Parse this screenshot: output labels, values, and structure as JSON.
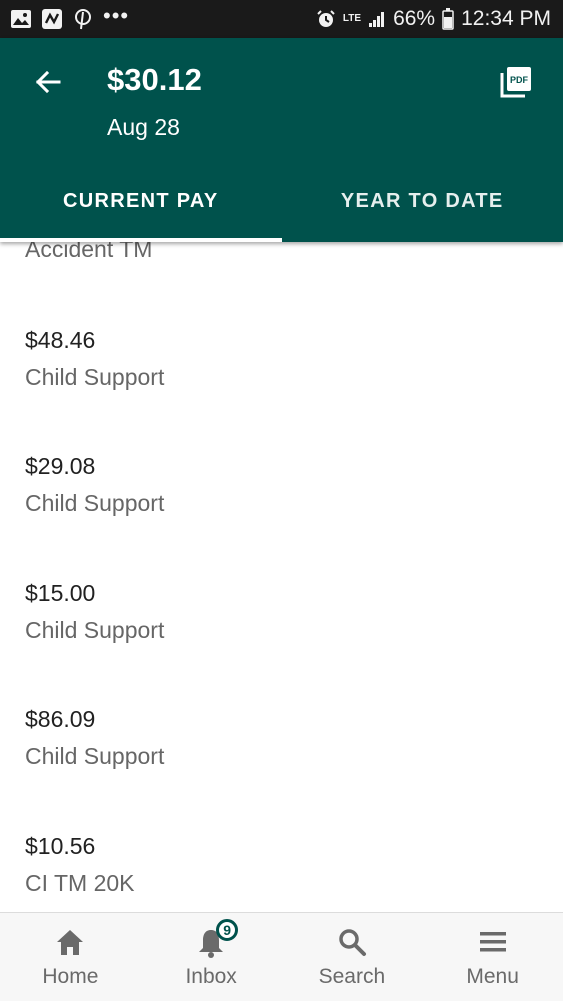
{
  "status_bar": {
    "network": "LTE",
    "battery": "66%",
    "time": "12:34 PM"
  },
  "header": {
    "amount": "$30.12",
    "date": "Aug 28",
    "back_icon": "arrow-back-icon",
    "pdf_icon": "pdf-icon"
  },
  "tabs": [
    {
      "label": "CURRENT PAY",
      "active": true
    },
    {
      "label": "YEAR TO DATE",
      "active": false
    }
  ],
  "partial_item": "Accident TM",
  "deductions": [
    {
      "amount": "$48.46",
      "name": "Child Support"
    },
    {
      "amount": "$29.08",
      "name": "Child Support"
    },
    {
      "amount": "$15.00",
      "name": "Child Support"
    },
    {
      "amount": "$86.09",
      "name": "Child Support"
    },
    {
      "amount": "$10.56",
      "name": "CI TM 20K"
    }
  ],
  "bottom_nav": [
    {
      "label": "Home",
      "icon": "home-icon"
    },
    {
      "label": "Inbox",
      "icon": "bell-icon",
      "badge": "9"
    },
    {
      "label": "Search",
      "icon": "search-icon"
    },
    {
      "label": "Menu",
      "icon": "menu-icon"
    }
  ],
  "colors": {
    "primary": "#00524c",
    "status_bar": "#1a1a1a"
  }
}
